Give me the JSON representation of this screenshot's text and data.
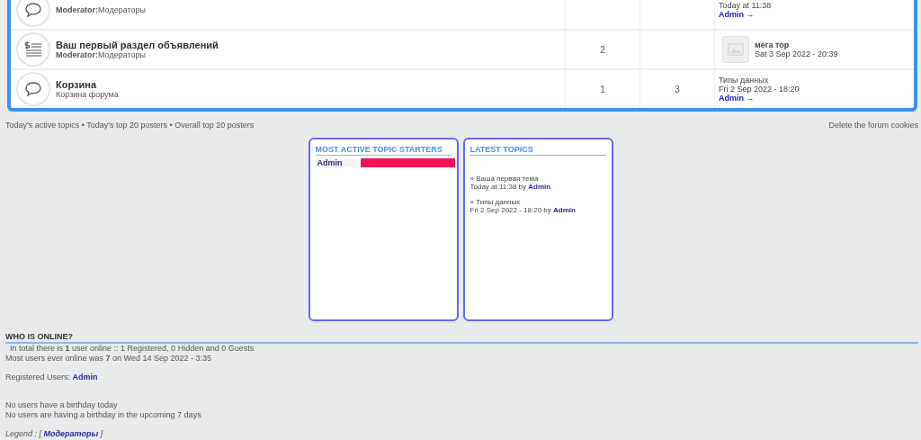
{
  "forums": [
    {
      "kind": "chat",
      "moderator_label": "Moderator:",
      "description": "Модераторы",
      "last_post": {
        "kind": "text",
        "date": "Today at 11:38",
        "author": "Admin",
        "arrow": "→"
      }
    },
    {
      "kind": "list",
      "title": "Ваш первый раздел объявлений",
      "moderator_label": "Moderator:",
      "description": "Модераторы",
      "topics": "2",
      "last_post": {
        "kind": "thumb",
        "topic": "мега тор",
        "date": "Sat 3 Sep 2022 - 20:39"
      }
    },
    {
      "kind": "chat",
      "title": "Корзина",
      "description": "Корзина форума",
      "topics": "1",
      "posts": "3",
      "last_post": {
        "kind": "text",
        "topic": "Типы данных",
        "date": "Fri 2 Sep 2022 - 18:20",
        "author": "Admin",
        "arrow": "→"
      }
    }
  ],
  "footer_links": [
    "Today's active topics",
    "Today's top 20 posters",
    "Overall top 20 posters"
  ],
  "footer_separator": "•",
  "delete_cookies": "Delete the forum cookies",
  "top_starters": {
    "title": "MOST ACTIVE TOPIC STARTERS",
    "rows": [
      {
        "name": "Admin",
        "level": 1
      }
    ]
  },
  "latest_topics": {
    "title": "LATEST TOPICS",
    "items": [
      {
        "title": "» Ваша первая тема",
        "date": "Today at 11:38 by",
        "author": "Admin"
      },
      {
        "title": "» Типы данных",
        "date": "Fri 2 Sep 2022 - 18:20 by",
        "author": "Admin"
      }
    ]
  },
  "who_is_online": {
    "title": "WHO IS ONLINE?",
    "total": "In total there is **1** user online :: 1 Registered, 0 Hidden and 0 Guests",
    "record": "Most users ever online was **7** on Wed 14 Sep 2022 - 3:35",
    "registered_label": "Registered Users:",
    "registered_user": "Admin",
    "birthday_today": "No users have a birthday today",
    "birthday_upcoming": "No users are having a birthday in the upcoming 7 days",
    "legend_label": "Legend :",
    "legend_open": "[",
    "legend_group": "Модераторы",
    "legend_close": "]"
  }
}
